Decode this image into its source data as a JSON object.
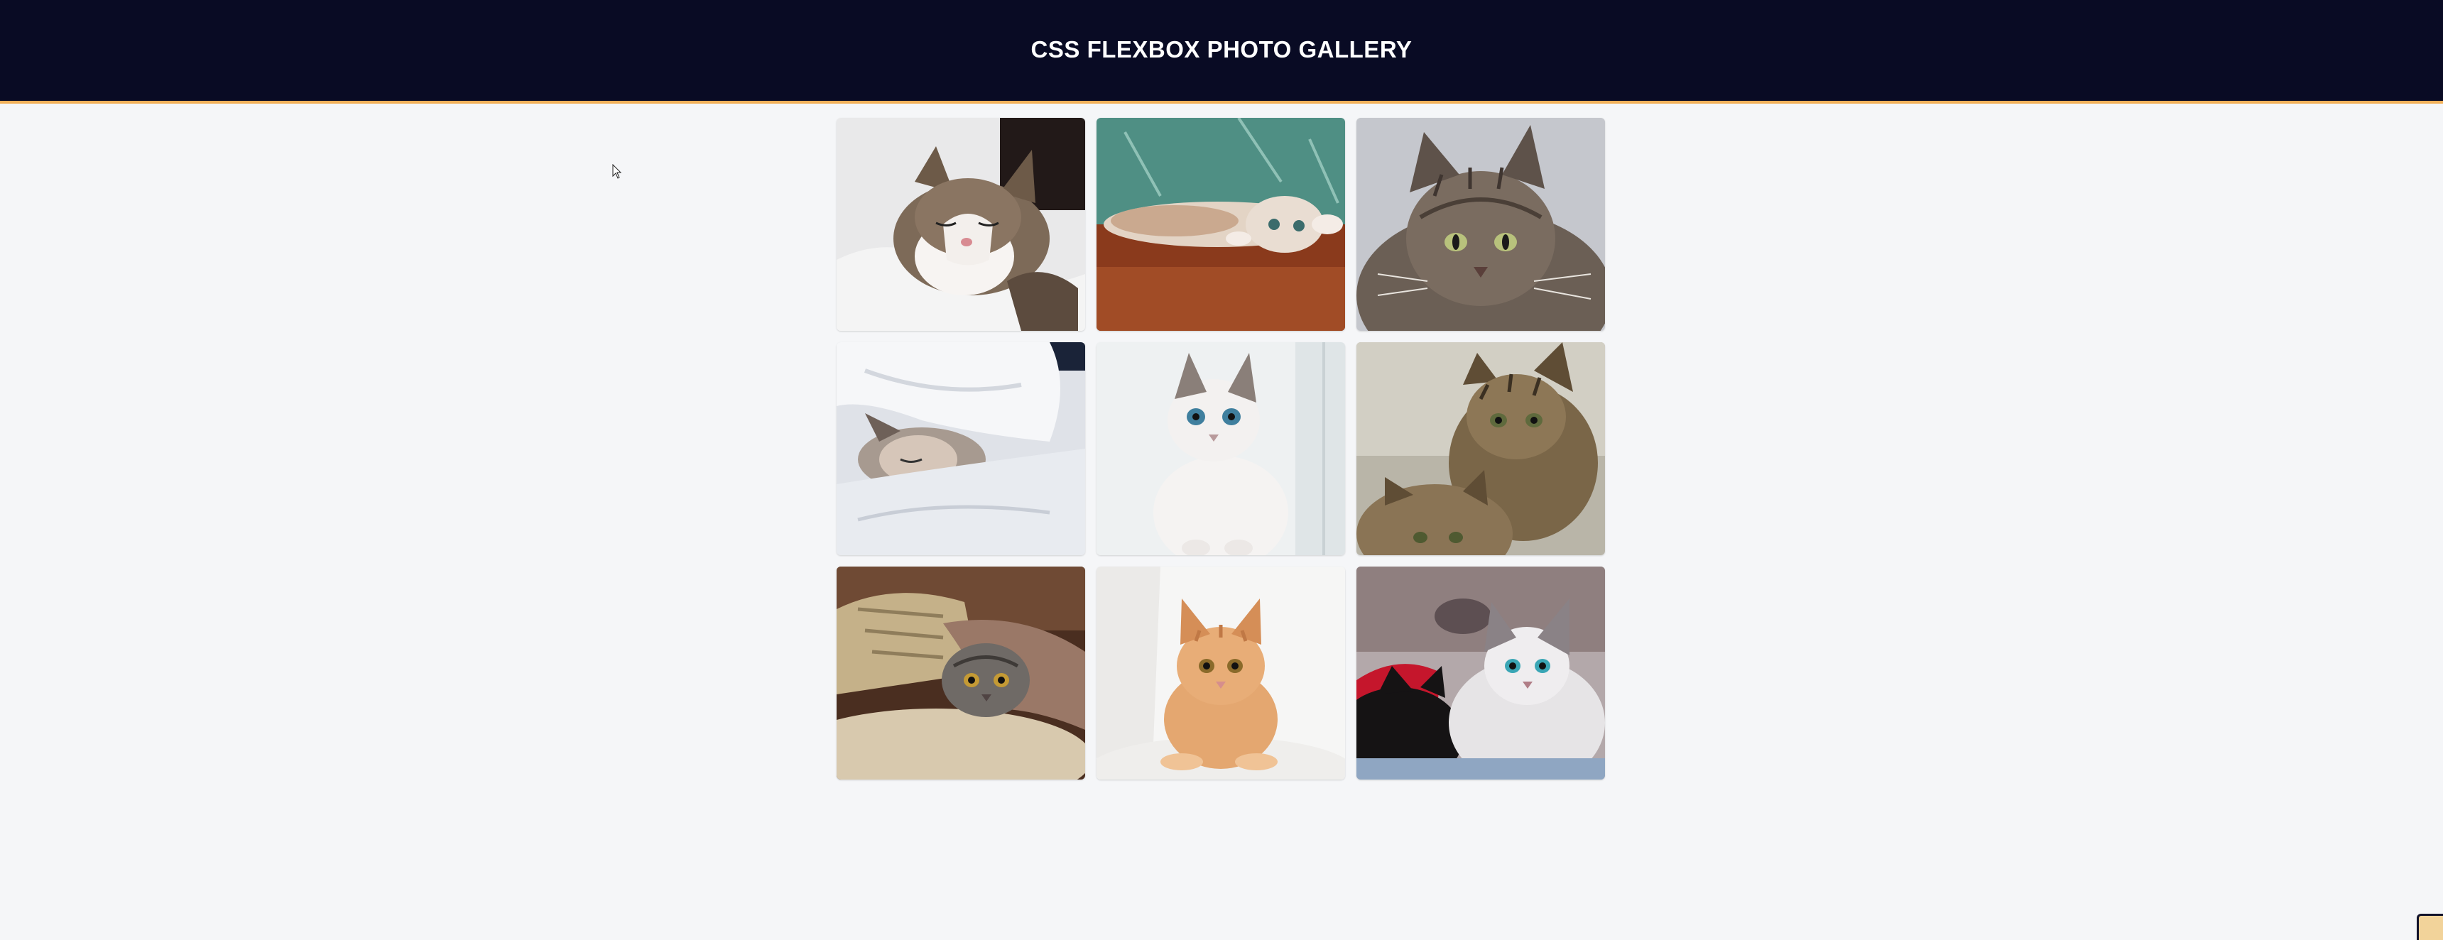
{
  "header": {
    "title": "CSS FLEXBOX PHOTO GALLERY",
    "background_color": "#090b24",
    "accent_border_color": "#f2b15a"
  },
  "gallery": {
    "photos": [
      {
        "subject": "sleeping tabby-and-white cat on white blanket",
        "icon": "cat-photo"
      },
      {
        "subject": "cat lying upside down on wooden floor",
        "icon": "cat-photo"
      },
      {
        "subject": "long-haired tabby cat portrait",
        "icon": "cat-photo"
      },
      {
        "subject": "kitten sleeping under white duvet",
        "icon": "cat-photo"
      },
      {
        "subject": "white siamese kitten with blue eyes",
        "icon": "cat-photo"
      },
      {
        "subject": "two tabby kittens",
        "icon": "cat-photo"
      },
      {
        "subject": "grey cat peeking from under blanket",
        "icon": "cat-photo"
      },
      {
        "subject": "orange kitten on white background",
        "icon": "cat-photo"
      },
      {
        "subject": "black and white kittens on blanket",
        "icon": "cat-photo"
      }
    ]
  },
  "page": {
    "background_color": "#f5f6f8"
  }
}
